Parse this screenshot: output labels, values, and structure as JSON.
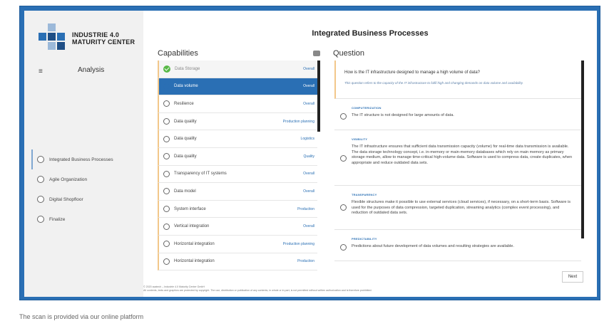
{
  "sidebar": {
    "logo_line1": "INDUSTRIE 4.0",
    "logo_line2": "MATURITY CENTER",
    "logo_colors": [
      "#9cb9d9",
      "#2a6fb4",
      "#1f4f86"
    ],
    "menu_icon": "≡",
    "section_title": "Analysis",
    "items": [
      {
        "label": "Integrated Business Processes",
        "active": true
      },
      {
        "label": "Agile Organization",
        "active": false
      },
      {
        "label": "Digital Shopfloor",
        "active": false
      },
      {
        "label": "Finalize",
        "active": false
      }
    ]
  },
  "main": {
    "title": "Integrated Business Processes",
    "capabilities_heading": "Capabilities",
    "question_heading": "Question",
    "capabilities": [
      {
        "name": "Data Storage",
        "tag": "Overall",
        "state": "done"
      },
      {
        "name": "Data volume",
        "tag": "Overall",
        "state": "selected"
      },
      {
        "name": "Resilience",
        "tag": "Overall",
        "state": "open"
      },
      {
        "name": "Data quality",
        "tag": "Production planning",
        "state": "open"
      },
      {
        "name": "Data quality",
        "tag": "Logistics",
        "state": "open"
      },
      {
        "name": "Data quality",
        "tag": "Quality",
        "state": "open"
      },
      {
        "name": "Transparency of IT systems",
        "tag": "Overall",
        "state": "open"
      },
      {
        "name": "Data model",
        "tag": "Overall",
        "state": "open"
      },
      {
        "name": "System interface",
        "tag": "Production",
        "state": "open"
      },
      {
        "name": "Vertical integration",
        "tag": "Overall",
        "state": "open"
      },
      {
        "name": "Horizontal integration",
        "tag": "Production planning",
        "state": "open"
      },
      {
        "name": "Horizontal integration",
        "tag": "Production",
        "state": "open"
      }
    ],
    "question": {
      "text": "How is the IT infrastructure designed to manage a high volume of data?",
      "subtext": "This question refers to the capacity of the IT infrastructure to fulfil high and changing demands on data volume and availability."
    },
    "options": [
      {
        "category": "COMPUTERIZATION",
        "text": "The IT structure is not designed for large amounts of data."
      },
      {
        "category": "VISIBILITY",
        "text": "The IT infrastructure ensures that sufficient data transmission capacity (volume) for real-time data transmission is available. The data storage technology concept, i.e. in-memory or main-memory databases which rely on main memory as primary storage medium, allow to manage time-critical high-volume data. Software is used to compress data, create duplicates, when appropriate and reduce outdated data sets."
      },
      {
        "category": "TRANSPARENCY",
        "text": "Flexible structures make it possible to use external services (cloud services), if necessary, on a short-term basis. Software is used for the purposes of data compression, targeted duplication, streaming analytics (complex event processing), and reduction of outdated data sets."
      },
      {
        "category": "PREDICTABILITY",
        "text": "Predictions about future development of data volumes and resulting strategies are available."
      }
    ],
    "next_label": "Next",
    "footer_line1": "© 2020 acatech – Industrie 4.0 Maturity Center GmbH",
    "footer_line2": "All contents, texts and graphics are protected by copyright. The use, distribution or publication of any contents, in whole or in part, is not permitted without written authorization and is therefore prohibited."
  },
  "caption": "The scan is provided via our online platform",
  "colors": {
    "frame": "#2a6fb4",
    "accent": "#2a6fb4",
    "capability_bar": "#f2c78a",
    "done_check": "#58b947"
  }
}
